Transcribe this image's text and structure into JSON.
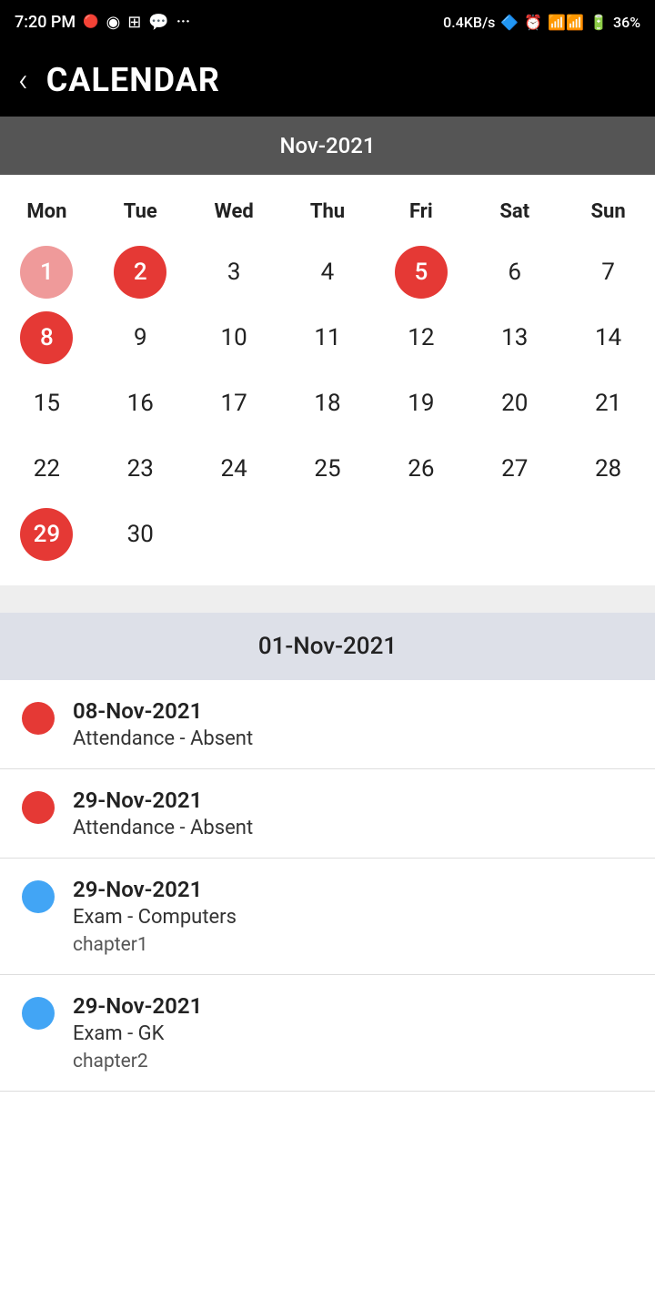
{
  "statusBar": {
    "time": "7:20 PM",
    "network": "0.4KB/s",
    "battery": "36%"
  },
  "header": {
    "backLabel": "‹",
    "title": "CALENDAR"
  },
  "calendar": {
    "monthLabel": "Nov-2021",
    "dayHeaders": [
      "Mon",
      "Tue",
      "Wed",
      "Thu",
      "Fri",
      "Sat",
      "Sun"
    ],
    "weeks": [
      [
        {
          "day": "1",
          "style": "red-light"
        },
        {
          "day": "2",
          "style": "red-full"
        },
        {
          "day": "3",
          "style": "none"
        },
        {
          "day": "4",
          "style": "none"
        },
        {
          "day": "5",
          "style": "red-full"
        },
        {
          "day": "6",
          "style": "none"
        },
        {
          "day": "7",
          "style": "none"
        }
      ],
      [
        {
          "day": "8",
          "style": "red-full"
        },
        {
          "day": "9",
          "style": "none"
        },
        {
          "day": "10",
          "style": "none"
        },
        {
          "day": "11",
          "style": "none"
        },
        {
          "day": "12",
          "style": "none"
        },
        {
          "day": "13",
          "style": "none"
        },
        {
          "day": "14",
          "style": "none"
        }
      ],
      [
        {
          "day": "15",
          "style": "none"
        },
        {
          "day": "16",
          "style": "none"
        },
        {
          "day": "17",
          "style": "none"
        },
        {
          "day": "18",
          "style": "none"
        },
        {
          "day": "19",
          "style": "none"
        },
        {
          "day": "20",
          "style": "none"
        },
        {
          "day": "21",
          "style": "none"
        }
      ],
      [
        {
          "day": "22",
          "style": "none"
        },
        {
          "day": "23",
          "style": "none"
        },
        {
          "day": "24",
          "style": "none"
        },
        {
          "day": "25",
          "style": "none"
        },
        {
          "day": "26",
          "style": "none"
        },
        {
          "day": "27",
          "style": "none"
        },
        {
          "day": "28",
          "style": "none"
        }
      ],
      [
        {
          "day": "29",
          "style": "red-full"
        },
        {
          "day": "30",
          "style": "none"
        },
        {
          "day": "",
          "style": "none"
        },
        {
          "day": "",
          "style": "none"
        },
        {
          "day": "",
          "style": "none"
        },
        {
          "day": "",
          "style": "none"
        },
        {
          "day": "",
          "style": "none"
        }
      ]
    ]
  },
  "eventsHeader": "01-Nov-2021",
  "events": [
    {
      "dot": "red",
      "date": "08-Nov-2021",
      "title": "Attendance - Absent",
      "subtitle": ""
    },
    {
      "dot": "red",
      "date": "29-Nov-2021",
      "title": "Attendance - Absent",
      "subtitle": ""
    },
    {
      "dot": "blue",
      "date": "29-Nov-2021",
      "title": "Exam - Computers",
      "subtitle": "chapter1"
    },
    {
      "dot": "blue",
      "date": "29-Nov-2021",
      "title": "Exam - GK",
      "subtitle": "chapter2"
    }
  ]
}
